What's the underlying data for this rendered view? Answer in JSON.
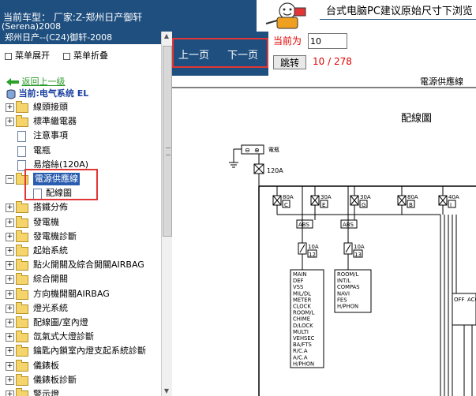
{
  "header": {
    "car_label": "当前车型：  厂家:Z-郑州日产御轩",
    "car_value": "(Serena)2008"
  },
  "banner": {
    "text": "台式电脑PC建议原始尺寸下浏览"
  },
  "left_panel": {
    "title": "郑州日产--(C24)御轩-2008",
    "expand_label": "菜单展开",
    "collapse_label": "菜单折叠",
    "back_label": "返回上一级",
    "current_label": "当前:电气系统 EL",
    "tree": [
      {
        "label": "線頭接頭",
        "type": "folder",
        "toggle": "+"
      },
      {
        "label": "標準繼電器",
        "type": "folder",
        "toggle": "+"
      },
      {
        "label": "注意事項",
        "type": "page",
        "toggle": ""
      },
      {
        "label": "電瓶",
        "type": "page",
        "toggle": ""
      },
      {
        "label": "易熔絲(120A)",
        "type": "page",
        "toggle": ""
      },
      {
        "label": "電源供應線",
        "type": "folder-open",
        "toggle": "−",
        "selected": true
      },
      {
        "label": "配線圖",
        "type": "page-child",
        "toggle": ""
      },
      {
        "label": "搭鐵分佈",
        "type": "folder",
        "toggle": "+"
      },
      {
        "label": "發電機",
        "type": "folder",
        "toggle": "+"
      },
      {
        "label": "發電機診斷",
        "type": "folder",
        "toggle": "+"
      },
      {
        "label": "起始系統",
        "type": "folder",
        "toggle": "+"
      },
      {
        "label": "點火開關及綜合開關AIRBAG",
        "type": "folder",
        "toggle": "+"
      },
      {
        "label": "綜合開關",
        "type": "folder",
        "toggle": "+"
      },
      {
        "label": "方向機開關AIRBAG",
        "type": "folder",
        "toggle": "+"
      },
      {
        "label": "燈光系統",
        "type": "folder",
        "toggle": "+"
      },
      {
        "label": "配線圖/室內燈",
        "type": "folder",
        "toggle": "+"
      },
      {
        "label": "氙氣式大燈診斷",
        "type": "folder",
        "toggle": "+"
      },
      {
        "label": "鑰匙內鎖室內燈支起系統診斷",
        "type": "folder",
        "toggle": "+"
      },
      {
        "label": "儀錶板",
        "type": "folder",
        "toggle": "+"
      },
      {
        "label": "儀錶板診斷",
        "type": "folder",
        "toggle": "+"
      },
      {
        "label": "警示燈",
        "type": "folder",
        "toggle": "+"
      }
    ]
  },
  "toolbar": {
    "prev_label": "上一页",
    "next_label": "下一页",
    "current_label": "当前为",
    "page_value": "10",
    "jump_label": "跳转",
    "page_count": "10 / 278"
  },
  "diagram": {
    "title": "電源供應線",
    "subtitle": "配線圖",
    "battery_label": "電瓶",
    "main_fuse": "120A",
    "fuses": [
      {
        "amp": "80A",
        "id": "C"
      },
      {
        "amp": "30A",
        "id": "E"
      },
      {
        "amp": "30A",
        "id": "G"
      },
      {
        "amp": "80A",
        "id": "B"
      },
      {
        "amp": "40A",
        "id": "I"
      }
    ],
    "abs_label_1": "ABS",
    "abs_label_2": "ABS",
    "sub_fuses": [
      {
        "amp": "10A",
        "id": "12"
      },
      {
        "amp": "10A",
        "id": "13"
      }
    ],
    "list_1": [
      "MAIN",
      "DEF",
      "VSS",
      "MIL/DL",
      "METER",
      "CLOCK",
      "ROOM/L",
      "CHIME",
      "D/LOCK",
      "MULTI",
      "VEHSEC",
      "BA/FTS",
      "R/C.A",
      "A/C.A",
      "H/PHON"
    ],
    "list_2": [
      "ROOM/L",
      "INT/L",
      "COMPAS",
      "NAVI",
      "FES",
      "H/PHON"
    ],
    "switch_labels": [
      "OFF",
      "ACC"
    ]
  },
  "colors": {
    "header_bg": "#1f4f7f",
    "highlight_red": "#e23636",
    "selection_blue": "#2a5db0"
  }
}
